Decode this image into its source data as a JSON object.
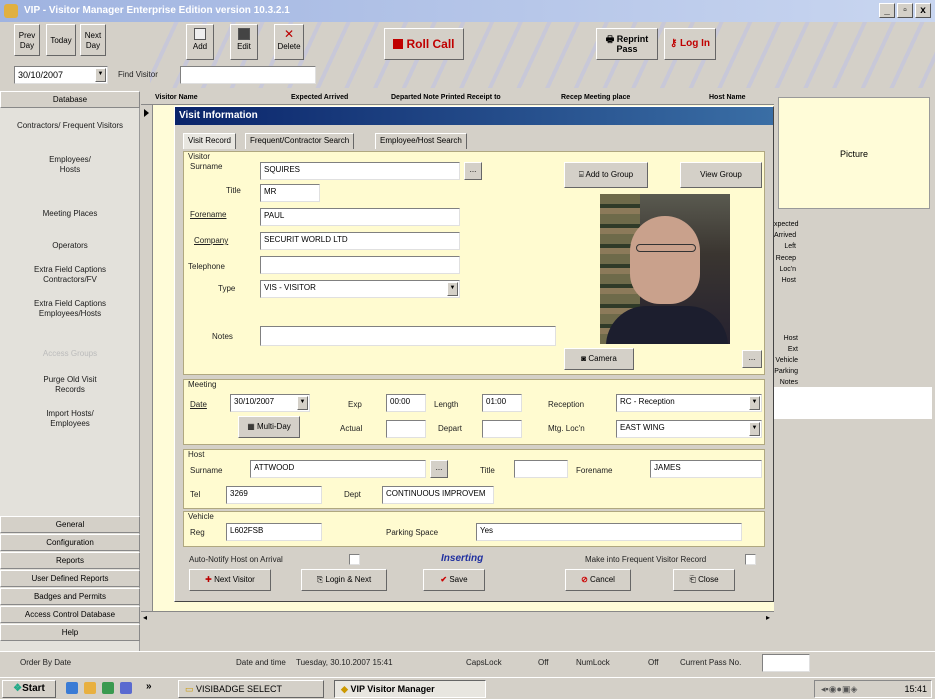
{
  "app": {
    "title": "VIP - Visitor Manager Enterprise Edition version 10.3.2.1",
    "min": "_",
    "max": "▫",
    "close": "x"
  },
  "toolbar": {
    "prev_day": "Prev Day",
    "today": "Today",
    "next_day": "Next Day",
    "add": "Add",
    "edit": "Edit",
    "delete": "Delete",
    "roll_call": "Roll Call",
    "reprint_pass": "Reprint Pass",
    "log_in": "Log In",
    "date": "30/10/2007",
    "find_visitor_label": "Find Visitor",
    "find_visitor_value": ""
  },
  "sidebar": {
    "database": "Database",
    "items": [
      "Contractors/ Frequent Visitors",
      "Employees/ Hosts",
      "Meeting Places",
      "Operators",
      "Extra Field Captions Contractors/FV",
      "Extra Field Captions Employees/Hosts",
      "Access Groups",
      "Purge Old Visit Records",
      "Import Hosts/ Employees"
    ],
    "bottom": [
      "General",
      "Configuration",
      "Reports",
      "User Defined Reports",
      "Badges and Permits",
      "Access Control Database",
      "Help"
    ]
  },
  "grid": {
    "columns": [
      "Visitor Name",
      "Expected Arrived",
      "Departed Note Printed Receipt to",
      "Recep Meeting place",
      "Host Name"
    ]
  },
  "right": {
    "picture": "Picture",
    "labels": [
      "xpected",
      "Arrived",
      "Left",
      "Recep",
      "Loc'n",
      "Host",
      "Host Ext",
      "Vehicle",
      "Parking",
      "Notes"
    ]
  },
  "dialog": {
    "title": "Visit Information",
    "tabs": [
      "Visit Record",
      "Frequent/Contractor Search",
      "Employee/Host Search"
    ],
    "visitor": {
      "group": "Visitor",
      "surname_label": "Surname",
      "surname": "SQUIRES",
      "title_label": "Title",
      "title": "MR",
      "forename_label": "Forename",
      "forename": "PAUL",
      "company_label": "Company",
      "company": "SECURIT WORLD LTD",
      "telephone_label": "Telephone",
      "telephone": "",
      "type_label": "Type",
      "type": "VIS - VISITOR",
      "notes_label": "Notes",
      "notes": "",
      "add_to_group": "Add to Group",
      "view_group": "View Group",
      "camera": "Camera",
      "ellipsis": "..."
    },
    "meeting": {
      "group": "Meeting",
      "date_label": "Date",
      "date": "30/10/2007",
      "exp_label": "Exp",
      "exp": "00:00",
      "length_label": "Length",
      "length": "01:00",
      "reception_label": "Reception",
      "reception": "RC - Reception",
      "multi_day": "Multi-Day",
      "actual_label": "Actual",
      "actual": "",
      "depart_label": "Depart",
      "depart": "",
      "mtg_loc_label": "Mtg. Loc'n",
      "mtg_loc": "EAST WING"
    },
    "host": {
      "group": "Host",
      "surname_label": "Surname",
      "surname": "ATTWOOD",
      "title_label": "Title",
      "title": "",
      "forename_label": "Forename",
      "forename": "JAMES",
      "tel_label": "Tel",
      "tel": "3269",
      "dept_label": "Dept",
      "dept": "CONTINUOUS IMPROVEM"
    },
    "vehicle": {
      "group": "Vehicle",
      "reg_label": "Reg",
      "reg": "L602FSB",
      "parking_label": "Parking Space",
      "parking": "Yes"
    },
    "bottom": {
      "auto_notify": "Auto-Notify Host on Arrival",
      "status": "Inserting",
      "make_frequent": "Make into Frequent Visitor Record",
      "next_visitor": "Next Visitor",
      "login_next": "Login & Next",
      "save": "Save",
      "cancel": "Cancel",
      "close": "Close"
    }
  },
  "status": {
    "order": "Order By Date",
    "datetime_label": "Date and time",
    "datetime": "Tuesday, 30.10.2007 15:41",
    "capslock": "CapsLock",
    "caps_val": "Off",
    "numlock": "NumLock",
    "num_val": "Off",
    "current_pass_label": "Current Pass No.",
    "current_pass": ""
  },
  "taskbar": {
    "start": "Start",
    "task1": "VISIBADGE SELECT",
    "task2": "VIP Visitor Manager",
    "clock": "15:41"
  }
}
